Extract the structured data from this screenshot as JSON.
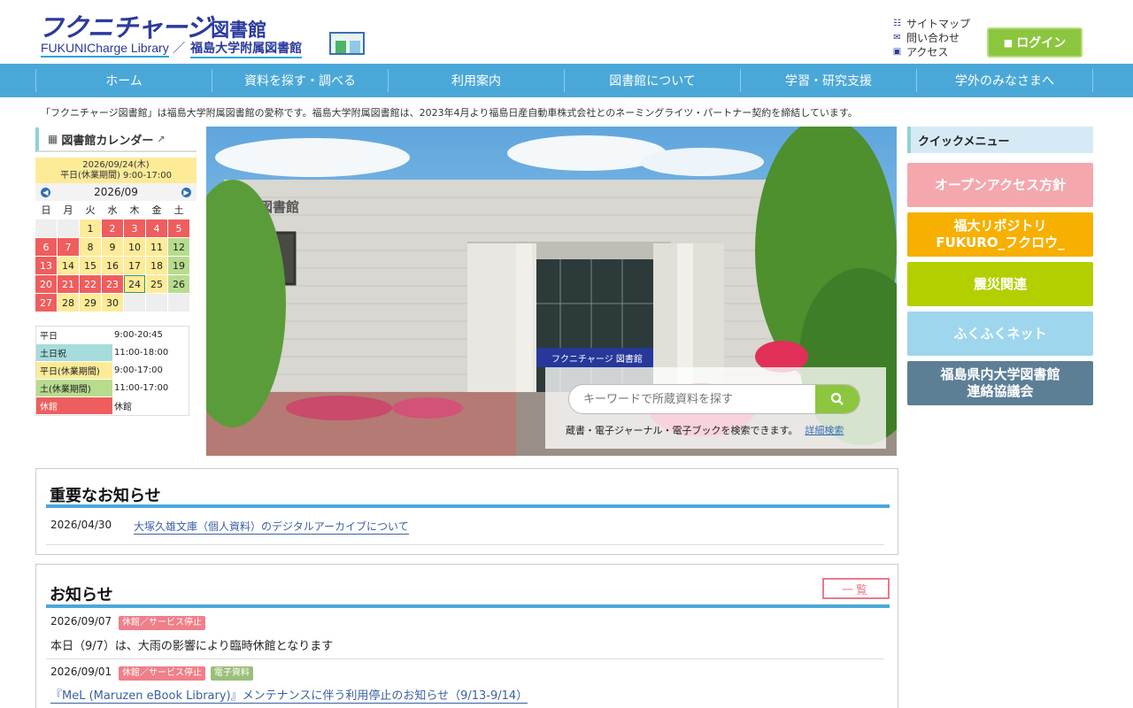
{
  "header": {
    "logo_main": "フクニチャージ",
    "logo_main_kanji": "図書館",
    "logo_en": "FUKUNICharge Library",
    "logo_slash": "／",
    "logo_jp": "福島大学附属図書館",
    "links": [
      {
        "icon": "sitemap-icon",
        "label": "サイトマップ"
      },
      {
        "icon": "mail-icon",
        "label": "問い合わせ"
      },
      {
        "icon": "train-icon",
        "label": "アクセス"
      }
    ],
    "login_label": "ログイン"
  },
  "nav": [
    "ホーム",
    "資料を探す・調べる",
    "利用案内",
    "図書館について",
    "学習・研究支援",
    "学外のみなさまへ"
  ],
  "notice_line": "「フクニチャージ図書館」は福島大学附属図書館の愛称です。福島大学附属図書館は、2023年4月より福島日産自動車株式会社とのネーミングライツ・パートナー契約を締結しています。",
  "calendar": {
    "title": "図書館カレンダー",
    "today_date": "2026/09/24(木)",
    "today_hours": "平日(休業期間) 9:00-17:00",
    "month": "2026/09",
    "weekdays": [
      "日",
      "月",
      "火",
      "水",
      "木",
      "金",
      "土"
    ],
    "weeks": [
      [
        {
          "d": "",
          "t": "empty"
        },
        {
          "d": "",
          "t": "empty"
        },
        {
          "d": "1",
          "t": "short"
        },
        {
          "d": "2",
          "t": "closed"
        },
        {
          "d": "3",
          "t": "closed"
        },
        {
          "d": "4",
          "t": "closed"
        },
        {
          "d": "5",
          "t": "closed"
        }
      ],
      [
        {
          "d": "6",
          "t": "closed"
        },
        {
          "d": "7",
          "t": "closed"
        },
        {
          "d": "8",
          "t": "short"
        },
        {
          "d": "9",
          "t": "short"
        },
        {
          "d": "10",
          "t": "short"
        },
        {
          "d": "11",
          "t": "short"
        },
        {
          "d": "12",
          "t": "sat"
        }
      ],
      [
        {
          "d": "13",
          "t": "closed"
        },
        {
          "d": "14",
          "t": "short"
        },
        {
          "d": "15",
          "t": "short"
        },
        {
          "d": "16",
          "t": "short"
        },
        {
          "d": "17",
          "t": "short"
        },
        {
          "d": "18",
          "t": "short"
        },
        {
          "d": "19",
          "t": "sat"
        }
      ],
      [
        {
          "d": "20",
          "t": "closed"
        },
        {
          "d": "21",
          "t": "closed"
        },
        {
          "d": "22",
          "t": "closed"
        },
        {
          "d": "23",
          "t": "closed"
        },
        {
          "d": "24",
          "t": "today"
        },
        {
          "d": "25",
          "t": "short"
        },
        {
          "d": "26",
          "t": "sat"
        }
      ],
      [
        {
          "d": "27",
          "t": "closed"
        },
        {
          "d": "28",
          "t": "short"
        },
        {
          "d": "29",
          "t": "short"
        },
        {
          "d": "30",
          "t": "short"
        },
        {
          "d": "",
          "t": "empty"
        },
        {
          "d": "",
          "t": "empty"
        },
        {
          "d": "",
          "t": "empty"
        }
      ]
    ],
    "legend": [
      {
        "key": "平日",
        "val": "9:00-20:45",
        "color": "#ffffff"
      },
      {
        "key": "土日祝",
        "val": "11:00-18:00",
        "color": "#a7dcdc"
      },
      {
        "key": "平日(休業期間)",
        "val": "9:00-17:00",
        "color": "#fdeb98"
      },
      {
        "key": "土(休業期間)",
        "val": "11:00-17:00",
        "color": "#b7dc8e"
      },
      {
        "key": "休館",
        "val": "休館",
        "color": "#ef5e5e"
      }
    ]
  },
  "hero": {
    "sign_text": "附属図書館",
    "entrance_text": "フクニチャージ 図書館",
    "search_placeholder": "キーワードで所蔵資料を探す",
    "search_note": "蔵書・電子ジャーナル・電子ブックを検索できます。",
    "advanced_link": "詳細検索"
  },
  "quick_menu": {
    "title": "クイックメニュー",
    "items": [
      {
        "label": "オープンアクセス方針",
        "color": "#f4a8ad"
      },
      {
        "label": "福大リポジトリ\nFUKURO_フクロウ_",
        "color": "#f7b000"
      },
      {
        "label": "震災関連",
        "color": "#b3cf00"
      },
      {
        "label": "ふくふくネット",
        "color": "#9ed6ee"
      },
      {
        "label": "福島県内大学図書館\n連絡協議会",
        "color": "#5c7f96"
      }
    ]
  },
  "important": {
    "title": "重要なお知らせ",
    "items": [
      {
        "date": "2026/04/30",
        "text": "大塚久雄文庫（個人資料）のデジタルアーカイブについて"
      }
    ]
  },
  "news": {
    "title": "お知らせ",
    "list_label": "一覧",
    "items": [
      {
        "date": "2026/09/07",
        "tags": [
          {
            "label": "休館／サービス停止",
            "color": "#ef7f8a"
          }
        ],
        "text": "本日（9/7）は、大雨の影響により臨時休館となります"
      },
      {
        "date": "2026/09/01",
        "tags": [
          {
            "label": "休館／サービス停止",
            "color": "#ef7f8a"
          },
          {
            "label": "電子資料",
            "color": "#9bbf7a"
          }
        ],
        "text": "『MeL (Maruzen eBook Library)』メンテナンスに伴う利用停止のお知らせ（9/13-9/14）"
      }
    ]
  }
}
